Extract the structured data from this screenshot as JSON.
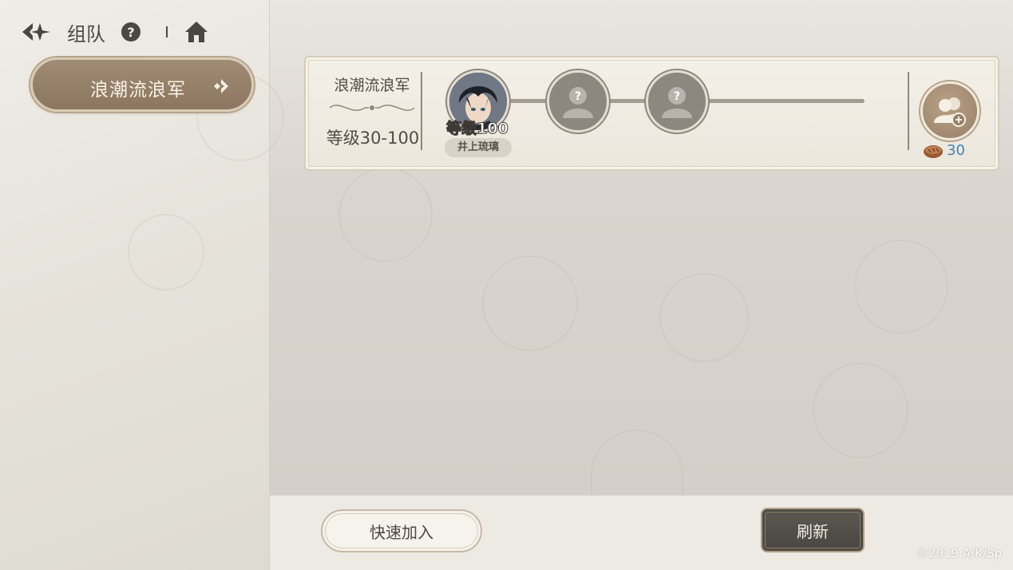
{
  "header": {
    "title": "组队",
    "back_icon": "back-arrow-icon",
    "help_label": "?",
    "home_icon": "home-icon"
  },
  "category_tab": {
    "label": "浪潮流浪军"
  },
  "team_card": {
    "name": "浪潮流浪军",
    "level_range": "等级30-100",
    "members": [
      {
        "level": "等级100",
        "name": "井上琉璃",
        "status": "filled"
      },
      {
        "status": "empty",
        "placeholder": "?"
      },
      {
        "status": "empty",
        "placeholder": "?"
      }
    ],
    "invite_icon": "add-friend-icon",
    "cost": "30",
    "cost_icon": "bread-icon"
  },
  "footer": {
    "quick_join_label": "快速加入",
    "refresh_label": "刷新"
  },
  "copyright": "©2019 A/K/Sp",
  "colors": {
    "accent_brown": "#8c7660",
    "cost_blue": "#3f83bd",
    "dark_button": "#4a4742"
  }
}
